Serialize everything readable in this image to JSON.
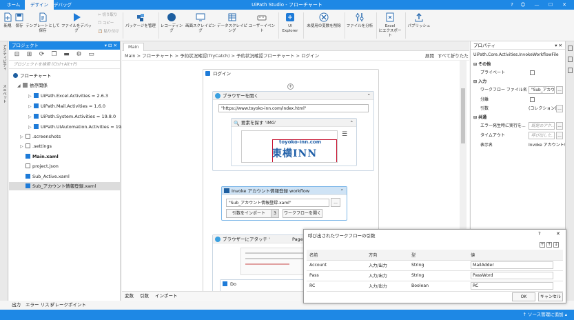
{
  "titlebar": {
    "tabs": [
      "ホーム",
      "デザイン",
      "デバッグ"
    ],
    "title": "UiPath Studio - フローチャート",
    "controls": [
      "?",
      "☺",
      "—",
      "☐",
      "✕"
    ]
  },
  "ribbon": {
    "new": "新規",
    "save": "保存",
    "save_template": "テンプレートとして保存",
    "debug_file": "ファイルをデバッグ",
    "cut": "切り取り",
    "copy": "コピー",
    "paste": "貼り付け",
    "manage_packages": "パッケージを管理",
    "recording": "レコーディング",
    "screen_scraping": "画面スクレイピング",
    "data_scraping": "データスクレイピング",
    "user_events": "ユーザーイベント",
    "ui_explorer_1": "UI",
    "ui_explorer_2": "Explorer",
    "remove_unused_vars": "未使用の変数を削除",
    "analyze_file": "ファイルを分析",
    "export_excel_1": "Excel",
    "export_excel_2": "にエクスポート",
    "publish": "パブリッシュ"
  },
  "leftstrip": {
    "activities": "アクティビティ",
    "snippets": "スニペット"
  },
  "project": {
    "header": "プロジェクト",
    "header_controls": "▾ ⊡ ✕",
    "search_placeholder": "プロジェクトを検索 (Ctrl+Alt+P)",
    "root": "フローチャート",
    "dependencies": "依存関係",
    "deps": [
      "UiPath.Excel.Activities = 2.6.3",
      "UiPath.Mail.Activities = 1.6.0",
      "UiPath.System.Activities = 19.8.0",
      "UiPath.UIAutomation.Activities = 19.8."
    ],
    "folders": [
      ".screenshots",
      ".settings"
    ],
    "files": [
      "Main.xaml",
      "project.json",
      "Sub_Active.xaml",
      "Sub_アカウント情報登録.xaml"
    ]
  },
  "main": {
    "doc_tab": "Main",
    "breadcrumb": "Main  >  フローチャート  >  予約状況確認(TryCatch)  >  予約状況確認フローチャート  >  ログイン",
    "expand": "展開",
    "collapse_all": "すべて折りたたみ",
    "login_seq": "ログイン",
    "browser_open": "ブラウザーを開く",
    "url": "\"https://www.toyoko-inn.com/index.html\"",
    "find_element": "要素を探す 'IMG'",
    "logo_url": "toyoko-inn.com",
    "logo_name": "東横INN",
    "invoke": "Invoke アカウント情報登録 workflow",
    "invoke_file": "\"Sub_アカウント情報登録.xaml\"",
    "import_args": "引数をインポート",
    "args_count": "3",
    "open_workflow": "ワークフローを開く",
    "attach_browser": "ブラウザーにアタッチ '",
    "attach_page": "Page'",
    "do": "Do",
    "bottom_tabs": [
      "変数",
      "引数",
      "インポート"
    ]
  },
  "properties": {
    "header": "プロパティ",
    "activity": "UiPath.Core.Activities.InvokeWorkflowFile",
    "groups": {
      "misc": "その他",
      "input": "入力",
      "common": "共通"
    },
    "rows": {
      "private": "プライベート",
      "wf_file": "ワークフロー ファイル名",
      "wf_file_val": "\"Sub_アカウ",
      "isolated": "分離",
      "args": "引数",
      "args_val": "(コレクション)",
      "continue_on_error": "エラー発生時に実行を...",
      "continue_placeholder": "既定のアク...",
      "timeout": "タイムアウト",
      "timeout_placeholder": "呼び出した...",
      "display_name": "表示名",
      "display_name_val": "Invoke アカウント!"
    }
  },
  "output_tabs": [
    "出力",
    "エラー リスト",
    "ブレークポイント"
  ],
  "statusbar": {
    "source_control": "↑ ソース管理に追加 ▴"
  },
  "dialog": {
    "title": "呼び出されたワークフローの引数",
    "help": "?",
    "close": "✕",
    "columns": [
      "名前",
      "方向",
      "型",
      "値"
    ],
    "rows": [
      {
        "name": "Account",
        "direction": "入力/出力",
        "type": "String",
        "value": "MailAdder"
      },
      {
        "name": "Pass",
        "direction": "入力/出力",
        "type": "String",
        "value": "PassWord"
      },
      {
        "name": "RC",
        "direction": "入力/出力",
        "type": "Boolean",
        "value": "RC"
      }
    ],
    "ok": "OK",
    "cancel": "キャンセル"
  },
  "colors": {
    "accent": "#1e88e5",
    "logo_red": "#c8102e",
    "logo_blue": "#1f5fa8"
  }
}
